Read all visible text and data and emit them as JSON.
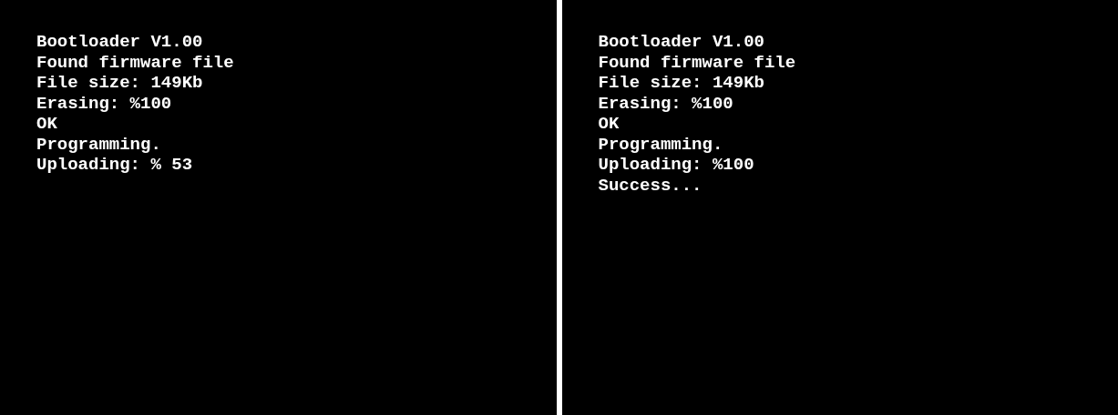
{
  "screens": [
    {
      "lines": [
        "Bootloader V1.00",
        "Found firmware file",
        "File size: 149Kb",
        "Erasing: %100",
        "OK",
        "Programming.",
        "Uploading: % 53"
      ]
    },
    {
      "lines": [
        "Bootloader V1.00",
        "Found firmware file",
        "File size: 149Kb",
        "Erasing: %100",
        "OK",
        "Programming.",
        "Uploading: %100",
        "Success..."
      ]
    }
  ]
}
